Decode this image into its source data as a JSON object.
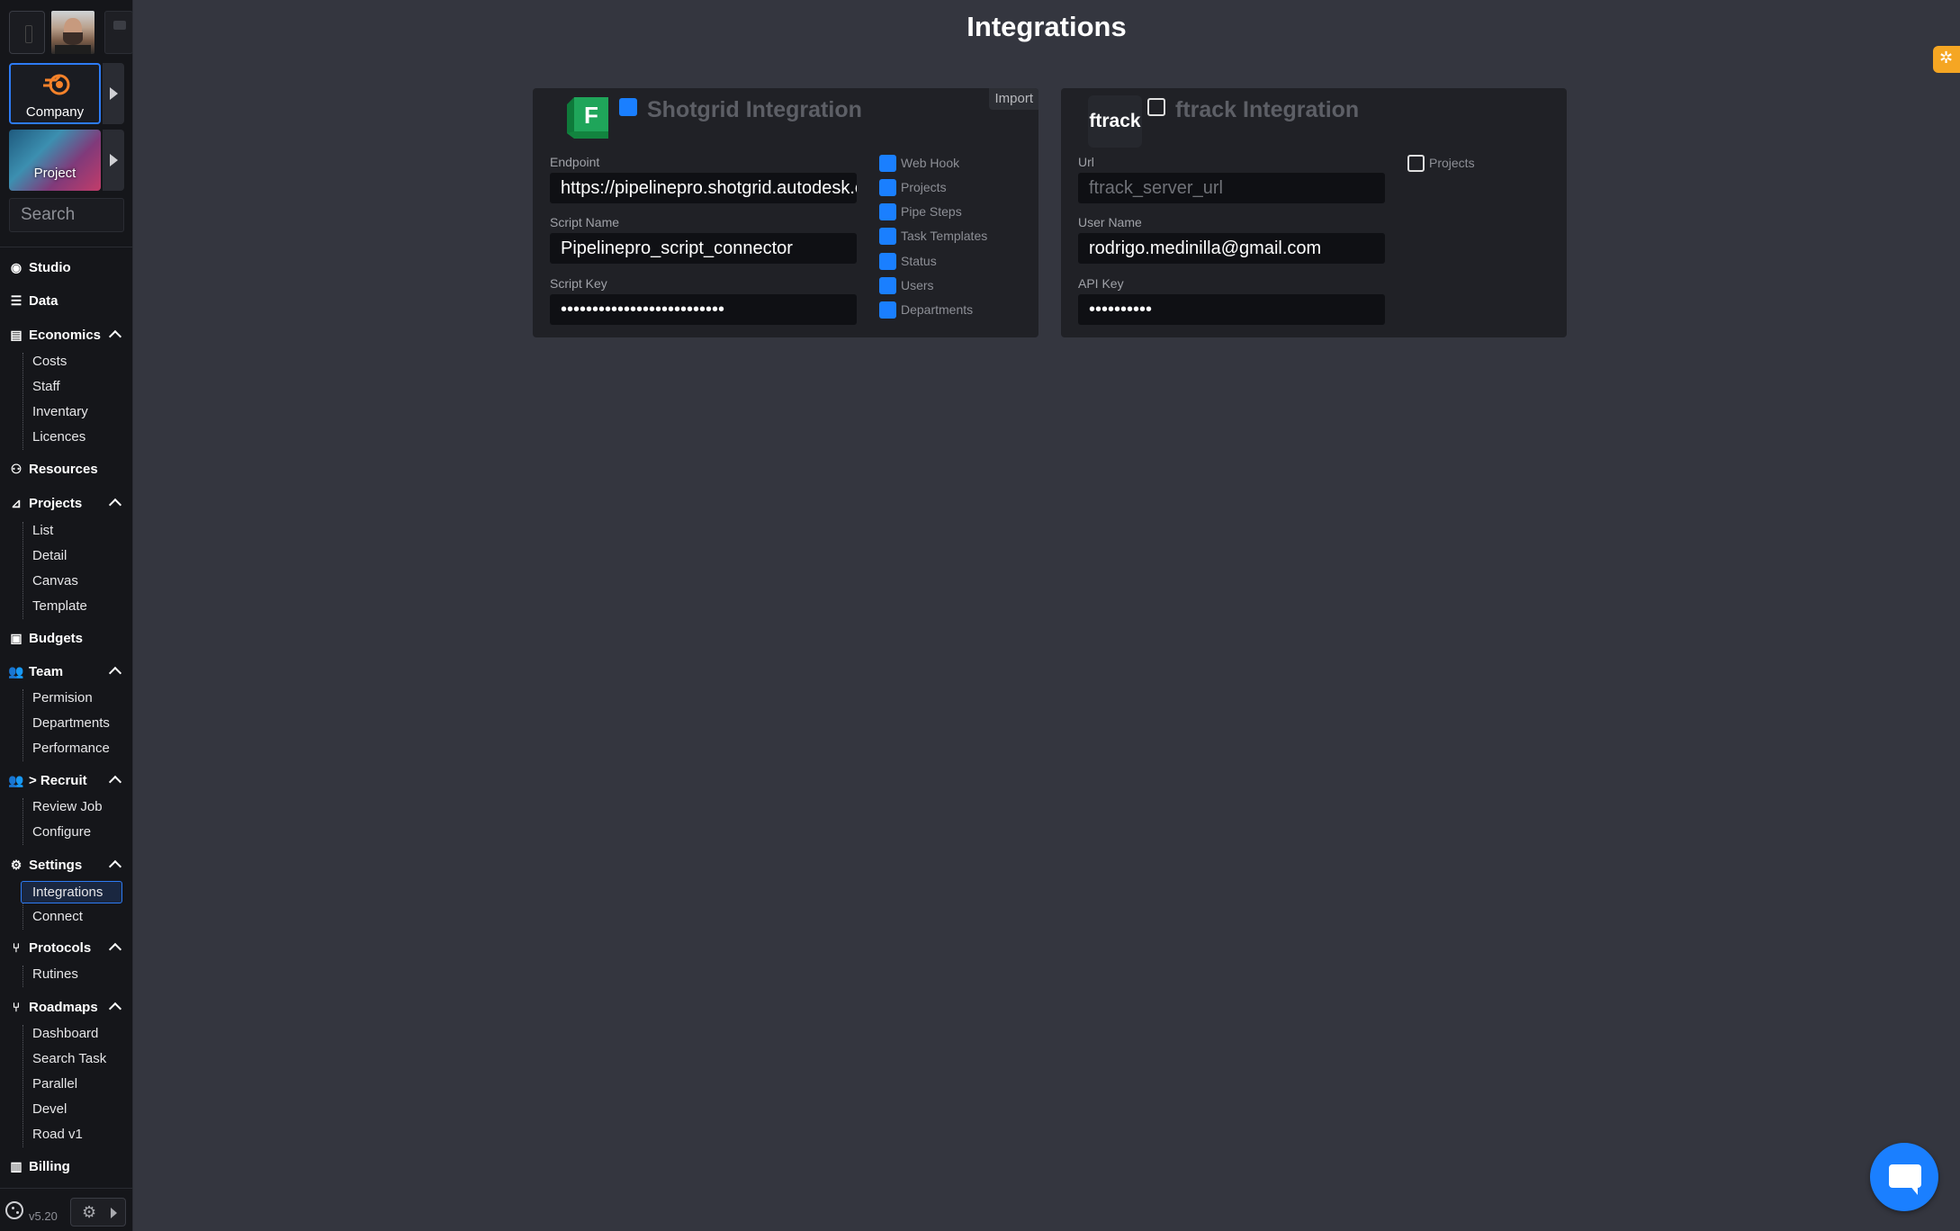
{
  "page": {
    "title": "Integrations"
  },
  "sidebar": {
    "company_label": "Company",
    "project_label": "Project",
    "search_placeholder": "Search",
    "nav": [
      {
        "label": "Studio"
      },
      {
        "label": "Data"
      },
      {
        "label": "Economics",
        "children": [
          "Costs",
          "Staff",
          "Inventary",
          "Licences"
        ]
      },
      {
        "label": "Resources"
      },
      {
        "label": "Projects",
        "children": [
          "List",
          "Detail",
          "Canvas",
          "Template"
        ]
      },
      {
        "label": "Budgets"
      },
      {
        "label": "Team",
        "children": [
          "Permision",
          "Departments",
          "Performance"
        ]
      },
      {
        "label": "> Recruit",
        "children": [
          "Review Job",
          "Configure"
        ]
      },
      {
        "label": "Settings",
        "children": [
          "Integrations",
          "Connect"
        ],
        "active_child": "Integrations"
      },
      {
        "label": "Protocols",
        "children": [
          "Rutines"
        ]
      },
      {
        "label": "Roadmaps",
        "children": [
          "Dashboard",
          "Search Task",
          "Parallel",
          "Devel",
          "Road v1"
        ]
      },
      {
        "label": "Billing"
      }
    ],
    "version": "v5.20"
  },
  "shotgrid": {
    "logo_letter": "F",
    "title": "Shotgrid Integration",
    "enabled": true,
    "import_label": "Import",
    "endpoint_label": "Endpoint",
    "endpoint_value": "https://pipelinepro.shotgrid.autodesk.com",
    "script_name_label": "Script Name",
    "script_name_value": "Pipelinepro_script_connector",
    "script_key_label": "Script Key",
    "script_key_value": "••••••••••••••••••••••••••",
    "options": [
      {
        "label": "Web Hook",
        "checked": true
      },
      {
        "label": "Projects",
        "checked": true
      },
      {
        "label": "Pipe Steps",
        "checked": true
      },
      {
        "label": "Task Templates",
        "checked": true
      },
      {
        "label": "Status",
        "checked": true
      },
      {
        "label": "Users",
        "checked": true
      },
      {
        "label": "Departments",
        "checked": true
      }
    ]
  },
  "ftrack": {
    "logo_text": "ftrack",
    "title": "ftrack Integration",
    "enabled": false,
    "url_label": "Url",
    "url_placeholder": "ftrack_server_url",
    "username_label": "User Name",
    "username_value": "rodrigo.medinilla@gmail.com",
    "apikey_label": "API Key",
    "apikey_value": "••••••••••",
    "options": [
      {
        "label": "Projects",
        "checked": false
      }
    ]
  },
  "colors": {
    "accent": "#1a7fff",
    "bg": "#34363f",
    "sidebar": "#15161a",
    "card": "#202126",
    "badge": "#f5a623"
  },
  "icons": [
    "blender-icon",
    "cookie-icon",
    "gear-icon",
    "chat-icon",
    "bug-icon"
  ]
}
